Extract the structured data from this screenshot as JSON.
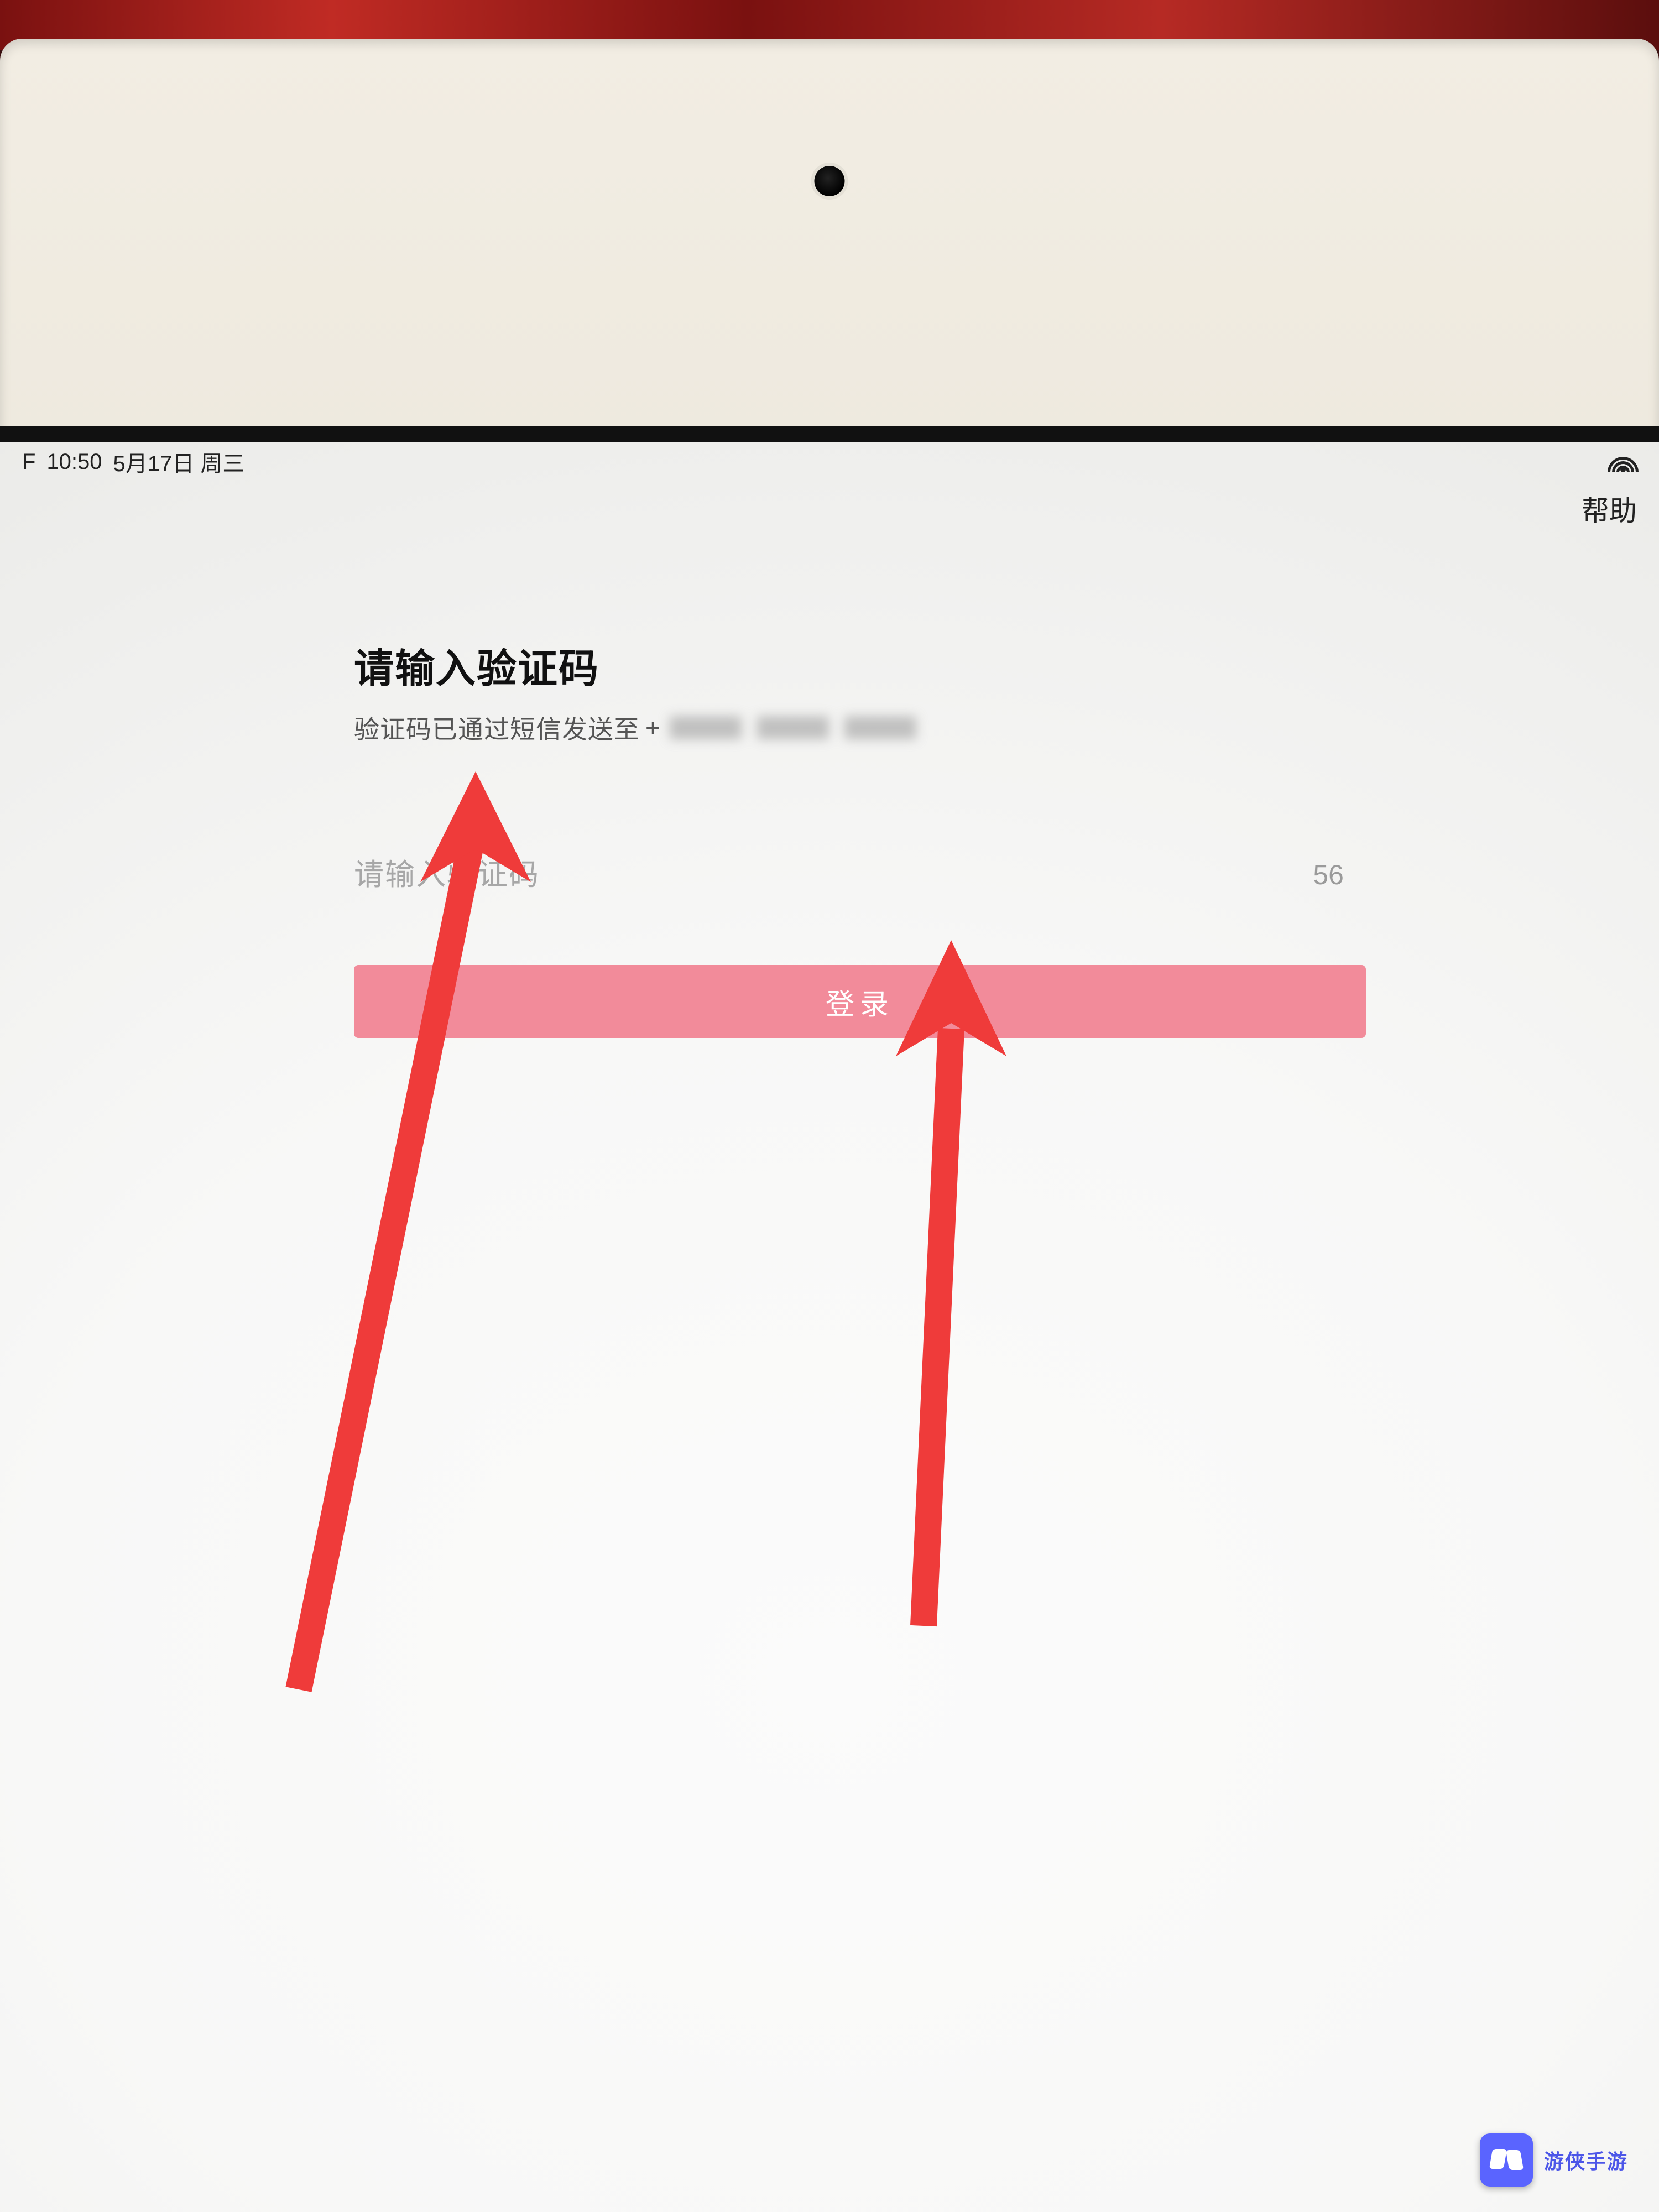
{
  "status_bar": {
    "time": "10:50",
    "date": "5月17日 周三",
    "time_prefix": "F"
  },
  "nav": {
    "help_label": "帮助"
  },
  "header": {
    "title": "请输入验证码",
    "subtitle_prefix": "验证码已通过短信发送至",
    "phone_prefix": "+"
  },
  "form": {
    "code_placeholder": "请输入验证码",
    "countdown": "56",
    "login_label": "登录"
  },
  "watermark": {
    "text": "游侠手游"
  },
  "colors": {
    "login_button": "#f28b9a",
    "annotation_arrow": "#ef3b3a",
    "watermark_accent": "#5a64ff"
  }
}
